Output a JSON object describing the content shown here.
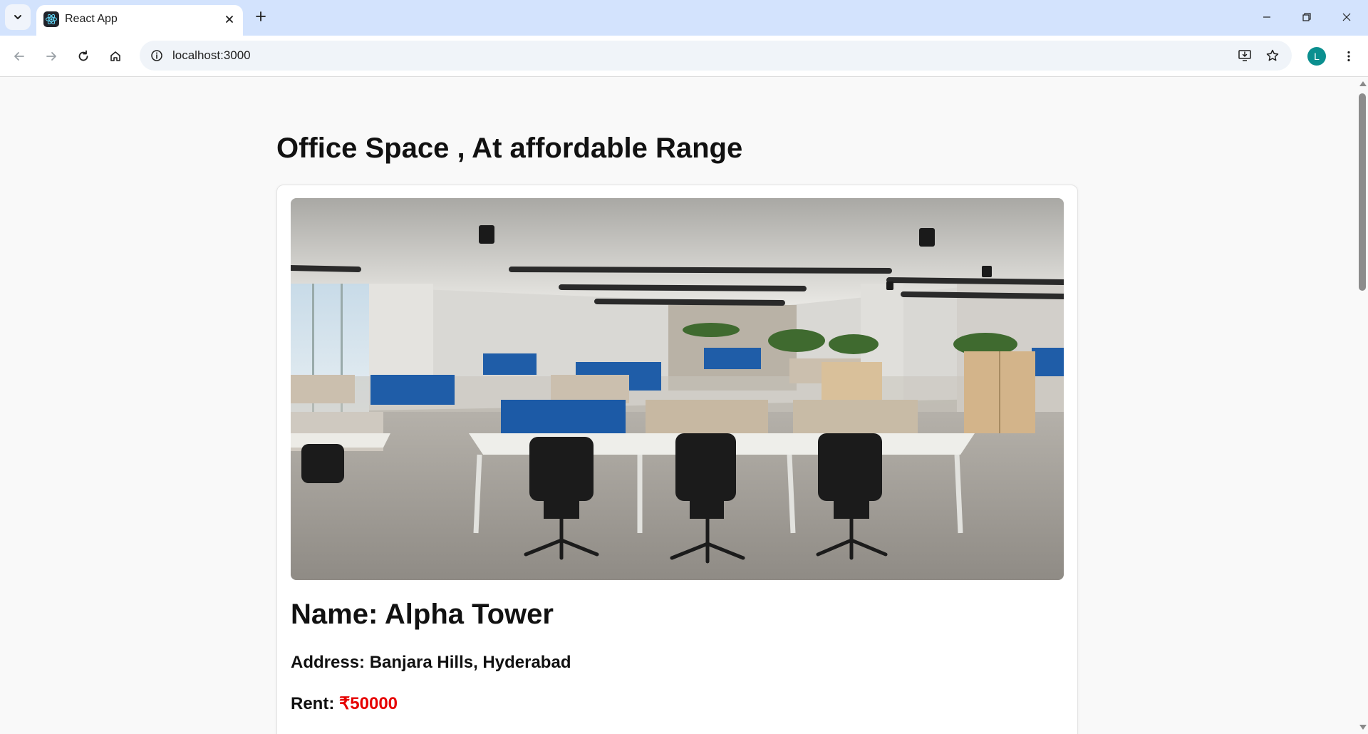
{
  "browser": {
    "tab": {
      "title": "React App",
      "favicon": "react-atom-icon"
    },
    "address_bar": {
      "url": "localhost:3000"
    },
    "profile": {
      "initial": "L",
      "color": "#0b8f8f"
    },
    "chrome_color": "#d3e3fd"
  },
  "page": {
    "heading": "Office Space , At affordable Range",
    "office": {
      "image": "office-interior-photo",
      "name_label": "Name: Alpha Tower",
      "address_label": "Address:",
      "address_value": "Banjara Hills, Hyderabad",
      "rent_label": "Rent:",
      "rent_value": "₹50000",
      "rent_color": "#e60000"
    }
  }
}
